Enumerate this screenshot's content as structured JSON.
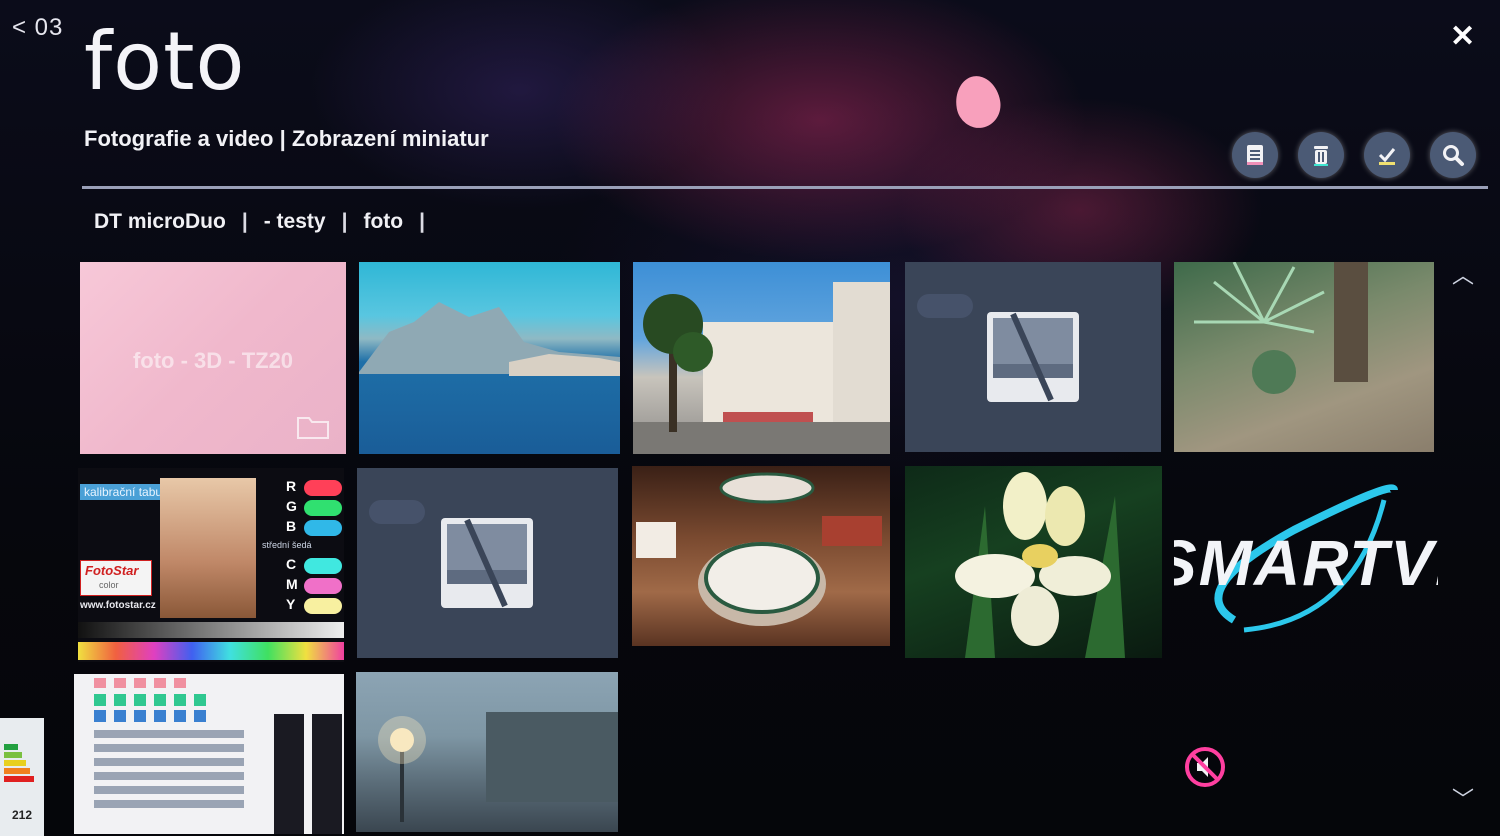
{
  "nav": {
    "back_label": "< 03"
  },
  "header": {
    "title": "foto",
    "subtitle": "Fotografie a video | Zobrazení miniatur"
  },
  "breadcrumb": {
    "items": [
      "DT microDuo",
      "- testy",
      "foto"
    ],
    "separator": "|"
  },
  "folder_tile": {
    "label": "foto - 3D - TZ20"
  },
  "calibration_tile": {
    "title": "kalibrační tabulka",
    "brand": "FotoStar",
    "brand_sub": "color",
    "url": "www.fotostar.cz",
    "rows": [
      "R",
      "G",
      "B",
      "C",
      "M",
      "Y"
    ],
    "gray_label": "střední šedá"
  },
  "logo_tile": {
    "text": "SMARTVIEW"
  },
  "energy_label": {
    "value": "212"
  },
  "colors": {
    "accent_pink": "#f8a0bc",
    "toolbar_button": "#4b5a75",
    "mute_pink": "#ff3fa0"
  },
  "icons": [
    "list-icon",
    "trash-icon",
    "check-icon",
    "search-icon",
    "close-icon",
    "chevron-up-icon",
    "chevron-down-icon",
    "mute-icon",
    "folder-icon",
    "image-placeholder-icon"
  ]
}
